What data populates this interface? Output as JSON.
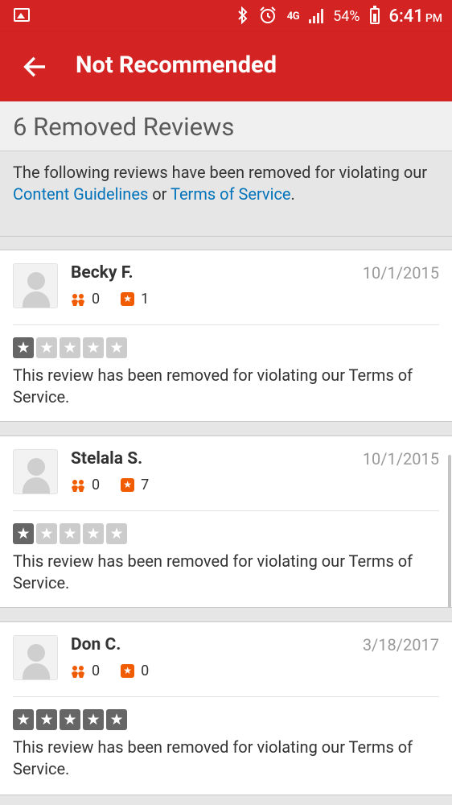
{
  "status_bar": {
    "network": "4G",
    "battery": "54%",
    "time": "6:41",
    "ampm": "PM",
    "icons": [
      "image-icon",
      "bluetooth-icon",
      "alarm-icon",
      "lte-icon",
      "signal-icon",
      "battery-icon"
    ]
  },
  "app_bar": {
    "title": "Not Recommended",
    "back_icon": "arrow-left-icon"
  },
  "header": {
    "title": "6 Removed Reviews"
  },
  "notice": {
    "prefix": "The following reviews have been removed for violating our ",
    "link1": "Content Guidelines",
    "middle": " or ",
    "link2": "Terms of Service",
    "suffix": "."
  },
  "reviews": [
    {
      "name": "Becky F.",
      "date": "10/1/2015",
      "friends": "0",
      "reviews": "1",
      "rating": 1,
      "text": "This review has been removed for violating our Terms of Service."
    },
    {
      "name": "Stelala S.",
      "date": "10/1/2015",
      "friends": "0",
      "reviews": "7",
      "rating": 1,
      "text": "This review has been removed for violating our Terms of Service."
    },
    {
      "name": "Don C.",
      "date": "3/18/2017",
      "friends": "0",
      "reviews": "0",
      "rating": 5,
      "text": "This review has been removed for violating our Terms of Service."
    }
  ],
  "colors": {
    "brand": "#d32323",
    "link": "#0073bb",
    "review_count": "#f15c00",
    "friends": "#f15c00",
    "star_filled": "#666666",
    "star_empty": "#cccccc"
  }
}
